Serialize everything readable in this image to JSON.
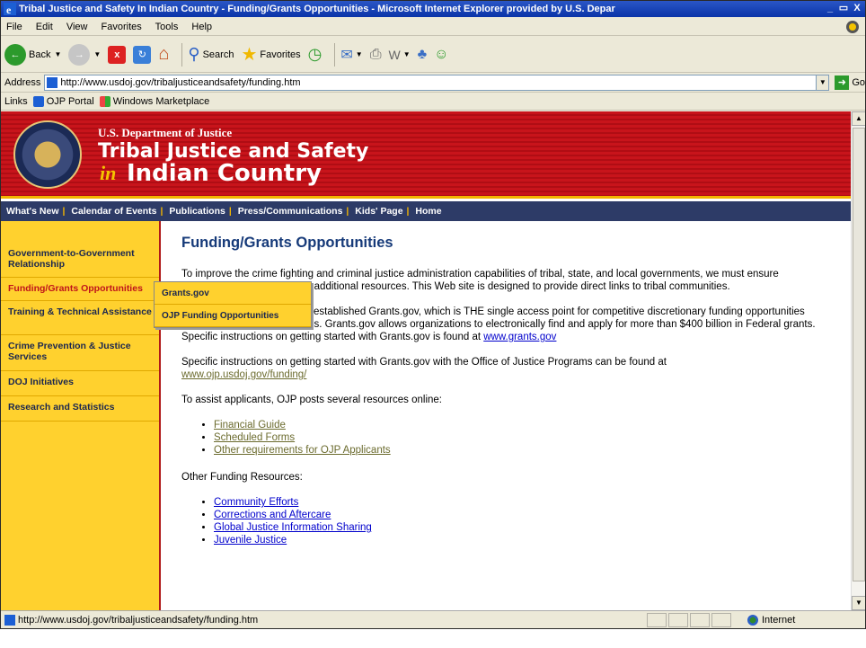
{
  "window": {
    "title": "Tribal Justice and Safety In Indian Country - Funding/Grants Opportunities - Microsoft Internet Explorer provided by U.S. Depar",
    "controls": [
      "_",
      "`",
      "X"
    ]
  },
  "menu": [
    "File",
    "Edit",
    "View",
    "Favorites",
    "Tools",
    "Help"
  ],
  "toolbar": {
    "back": "Back",
    "search": "Search",
    "favorites": "Favorites"
  },
  "address": {
    "label": "Address",
    "url": "http://www.usdoj.gov/tribaljusticeandsafety/funding.htm",
    "go": "Go"
  },
  "links": {
    "label": "Links",
    "items": [
      "OJP Portal",
      "Windows Marketplace"
    ]
  },
  "banner": {
    "dept": "U.S. Department of Justice",
    "title_line1": "Tribal Justice and Safety",
    "title_in": "in",
    "title_line2": "Indian Country"
  },
  "nav": [
    "What's New",
    "Calendar of Events",
    "Publications",
    "Press/Communications",
    "Kids' Page",
    "Home"
  ],
  "sidebar": {
    "items": [
      "Government-to-Government Relationship",
      "Funding/Grants Opportunities",
      "Training & Technical Assistance",
      "Crime Prevention & Justice Services",
      "DOJ Initiatives",
      "Research and Statistics"
    ]
  },
  "flyout": [
    "Grants.gov",
    "OJP Funding Opportunities"
  ],
  "main": {
    "heading": "Funding/Grants Opportunities",
    "p1": "To improve the crime fighting and criminal justice administration capabilities of tribal, state, and local governments, we must ensure communities have access to additional resources. This Web site is designed to provide direct links to tribal communities.",
    "p2_text": "The federal government has established Grants.gov, which is THE single access point for competitive discretionary funding opportunities offered by all federal agencies. Grants.gov allows organizations to electronically find and apply for more than $400 billion in Federal grants. Specific instructions on getting started with Grants.gov is found at ",
    "p2_link": "www.grants.gov",
    "p3_text": "Specific instructions on getting started with Grants.gov with the Office of Justice Programs can be found at ",
    "p3_link": "www.ojp.usdoj.gov/funding/",
    "p4": "To assist applicants, OJP posts several resources online:",
    "resources": [
      "Financial Guide",
      "Scheduled Forms",
      "Other requirements for OJP Applicants"
    ],
    "p5": "Other Funding Resources:",
    "other": [
      "Community Efforts",
      "Corrections and Aftercare",
      "Global Justice Information Sharing",
      "Juvenile Justice"
    ]
  },
  "status": {
    "text": "http://www.usdoj.gov/tribaljusticeandsafety/funding.htm",
    "zone": "Internet"
  }
}
